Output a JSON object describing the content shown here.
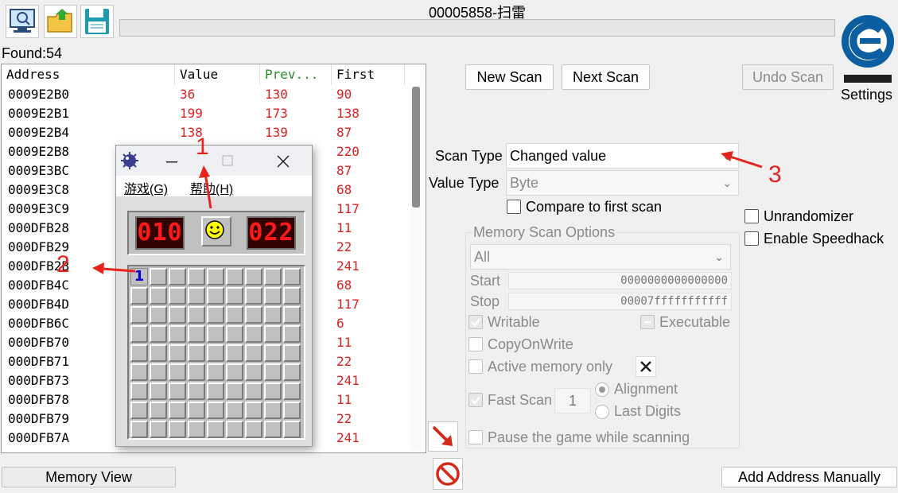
{
  "window": {
    "title": "00005858-扫雷"
  },
  "toolbar": {
    "open_process_icon": "monitor-icon",
    "open_file_icon": "folder-icon",
    "save_icon": "floppy-icon"
  },
  "found_label": "Found:54",
  "columns": {
    "address": "Address",
    "value": "Value",
    "previous": "Prev...",
    "first": "First"
  },
  "rows": [
    {
      "address": "0009E2B0",
      "value": "36",
      "previous": "130",
      "first": "90"
    },
    {
      "address": "0009E2B1",
      "value": "199",
      "previous": "173",
      "first": "138"
    },
    {
      "address": "0009E2B4",
      "value": "138",
      "previous": "139",
      "first": "87"
    },
    {
      "address": "0009E2B8",
      "value": "",
      "previous": "",
      "first": "220"
    },
    {
      "address": "0009E3BC",
      "value": "",
      "previous": "",
      "first": "87"
    },
    {
      "address": "0009E3C8",
      "value": "",
      "previous": "",
      "first": "68"
    },
    {
      "address": "0009E3C9",
      "value": "",
      "previous": "",
      "first": "117"
    },
    {
      "address": "000DFB28",
      "value": "",
      "previous": "",
      "first": "11"
    },
    {
      "address": "000DFB29",
      "value": "",
      "previous": "",
      "first": "22"
    },
    {
      "address": "000DFB2B",
      "value": "",
      "previous": "",
      "first": "241"
    },
    {
      "address": "000DFB4C",
      "value": "",
      "previous": "",
      "first": "68"
    },
    {
      "address": "000DFB4D",
      "value": "",
      "previous": "",
      "first": "117"
    },
    {
      "address": "000DFB6C",
      "value": "",
      "previous": "",
      "first": "6"
    },
    {
      "address": "000DFB70",
      "value": "",
      "previous": "",
      "first": "11"
    },
    {
      "address": "000DFB71",
      "value": "",
      "previous": "",
      "first": "22"
    },
    {
      "address": "000DFB73",
      "value": "",
      "previous": "",
      "first": "241"
    },
    {
      "address": "000DFB78",
      "value": "",
      "previous": "",
      "first": "11"
    },
    {
      "address": "000DFB79",
      "value": "",
      "previous": "",
      "first": "22"
    },
    {
      "address": "000DFB7A",
      "value": "",
      "previous": "",
      "first": "241"
    }
  ],
  "buttons": {
    "new_scan": "New Scan",
    "next_scan": "Next Scan",
    "undo_scan": "Undo Scan",
    "memory_view": "Memory View",
    "add_address": "Add Address Manually",
    "settings": "Settings"
  },
  "scan": {
    "scan_type_label": "Scan Type",
    "scan_type_value": "Changed value",
    "value_type_label": "Value Type",
    "value_type_value": "Byte",
    "compare_first": "Compare to first scan",
    "unrandomizer": "Unrandomizer",
    "speedhack": "Enable Speedhack"
  },
  "memory_options": {
    "title": "Memory Scan Options",
    "region": "All",
    "start_label": "Start",
    "start_value": "0000000000000000",
    "stop_label": "Stop",
    "stop_value": "00007fffffffffff",
    "writable": "Writable",
    "executable": "Executable",
    "copy_on_write": "CopyOnWrite",
    "active_memory": "Active memory only",
    "fast_scan": "Fast Scan",
    "fast_scan_value": "1",
    "alignment": "Alignment",
    "last_digits": "Last Digits",
    "pause_game": "Pause the game while scanning"
  },
  "minesweeper": {
    "menu_game": "游戏(G)",
    "menu_help": "帮助(H)",
    "mine_counter": "010",
    "timer": "022",
    "revealed_cell": "1",
    "grid_rows": 9,
    "grid_cols": 9
  },
  "annotations": {
    "a1": "1",
    "a2": "2",
    "a3": "3"
  },
  "colors": {
    "value_red": "#e02020",
    "prev_green": "#2a8a2a",
    "annotation_red": "#e8231b",
    "lcd_red": "#ff1a1a"
  }
}
